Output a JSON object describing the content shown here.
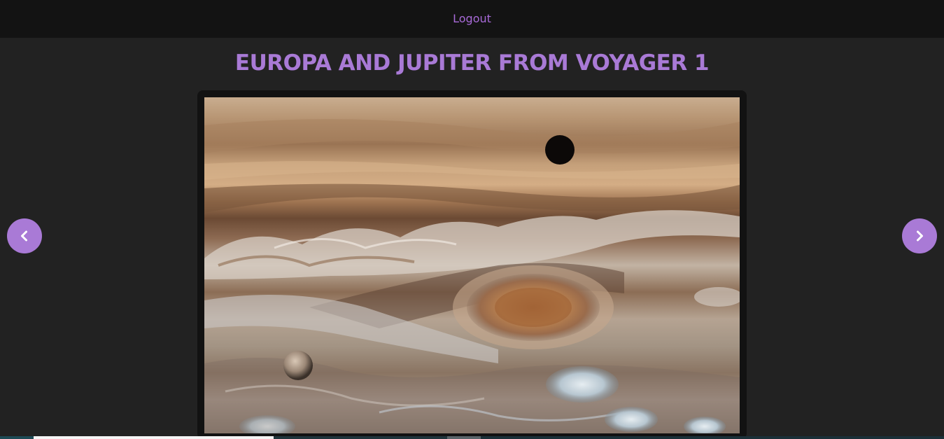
{
  "header": {
    "logout_label": "Logout"
  },
  "gallery": {
    "title": "EUROPA AND JUPITER FROM VOYAGER 1",
    "image_alt": "Europa and Jupiter from Voyager 1",
    "prev_icon": "chevron-left-icon",
    "next_icon": "chevron-right-icon"
  },
  "colors": {
    "accent": "#a97ad6",
    "background": "#222222",
    "topbar": "#131313"
  }
}
